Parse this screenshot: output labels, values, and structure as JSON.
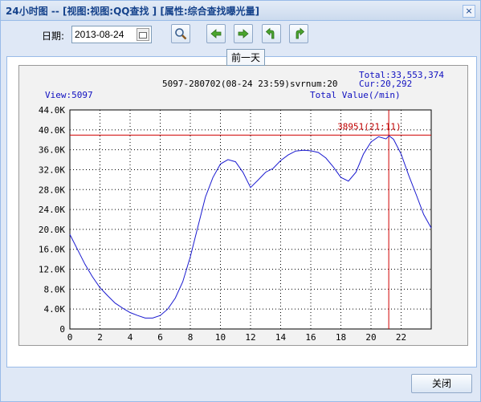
{
  "window": {
    "title": "24小时图 -- [视图:视图:QQ查找 ] [属性:综合查找曝光量]",
    "close_glyph": "×"
  },
  "toolbar": {
    "date_label": "日期:",
    "date_value": "2013-08-24",
    "tooltip": "前一天",
    "buttons": [
      "zoom-icon",
      "prev-day-icon",
      "next-day-icon",
      "undo-icon",
      "redo-icon"
    ]
  },
  "footer": {
    "close_label": "关闭"
  },
  "chart_header": {
    "total": "Total:33,553,374",
    "cur": "Cur:20,292",
    "info": "5097-280702(08-24 23:59)svrnum:20",
    "view": "View:5097",
    "unit": "Total Value(/min)",
    "peak_label": "38951(21:11)"
  },
  "chart_data": {
    "type": "line",
    "x_ticks": [
      "0",
      "2",
      "4",
      "6",
      "8",
      "10",
      "12",
      "14",
      "16",
      "18",
      "20",
      "22"
    ],
    "y_ticks": [
      "0",
      "4.0K",
      "8.0K",
      "12.0K",
      "16.0K",
      "20.0K",
      "24.0K",
      "28.0K",
      "32.0K",
      "36.0K",
      "40.0K",
      "44.0K"
    ],
    "xlim": [
      0,
      24
    ],
    "ylim": [
      0,
      44000
    ],
    "grid": true,
    "peak": {
      "x": 21.18,
      "y": 38951
    },
    "series": [
      {
        "x": [
          0,
          0.5,
          1,
          1.5,
          2,
          2.5,
          3,
          3.5,
          4,
          4.5,
          5,
          5.5,
          6,
          6.5,
          7,
          7.5,
          8,
          8.5,
          9,
          9.5,
          10,
          10.5,
          11,
          11.5,
          12,
          12.5,
          13,
          13.5,
          14,
          14.5,
          15,
          15.5,
          16,
          16.5,
          17,
          17.5,
          18,
          18.5,
          19,
          19.5,
          20,
          20.5,
          21,
          21.2,
          21.5,
          22,
          22.5,
          23,
          23.5,
          24
        ],
        "y": [
          19000,
          16000,
          13000,
          10500,
          8300,
          6700,
          5200,
          4200,
          3300,
          2700,
          2200,
          2200,
          2700,
          4000,
          6200,
          9500,
          14500,
          20500,
          26500,
          30500,
          33000,
          34000,
          33500,
          31500,
          28600,
          30000,
          31500,
          32500,
          34000,
          35000,
          35500,
          35800,
          35900,
          35500,
          34500,
          32500,
          30200,
          29500,
          31500,
          35000,
          37500,
          38400,
          38200,
          38951,
          38000,
          35000,
          31000,
          27000,
          23000,
          20292
        ]
      }
    ]
  }
}
